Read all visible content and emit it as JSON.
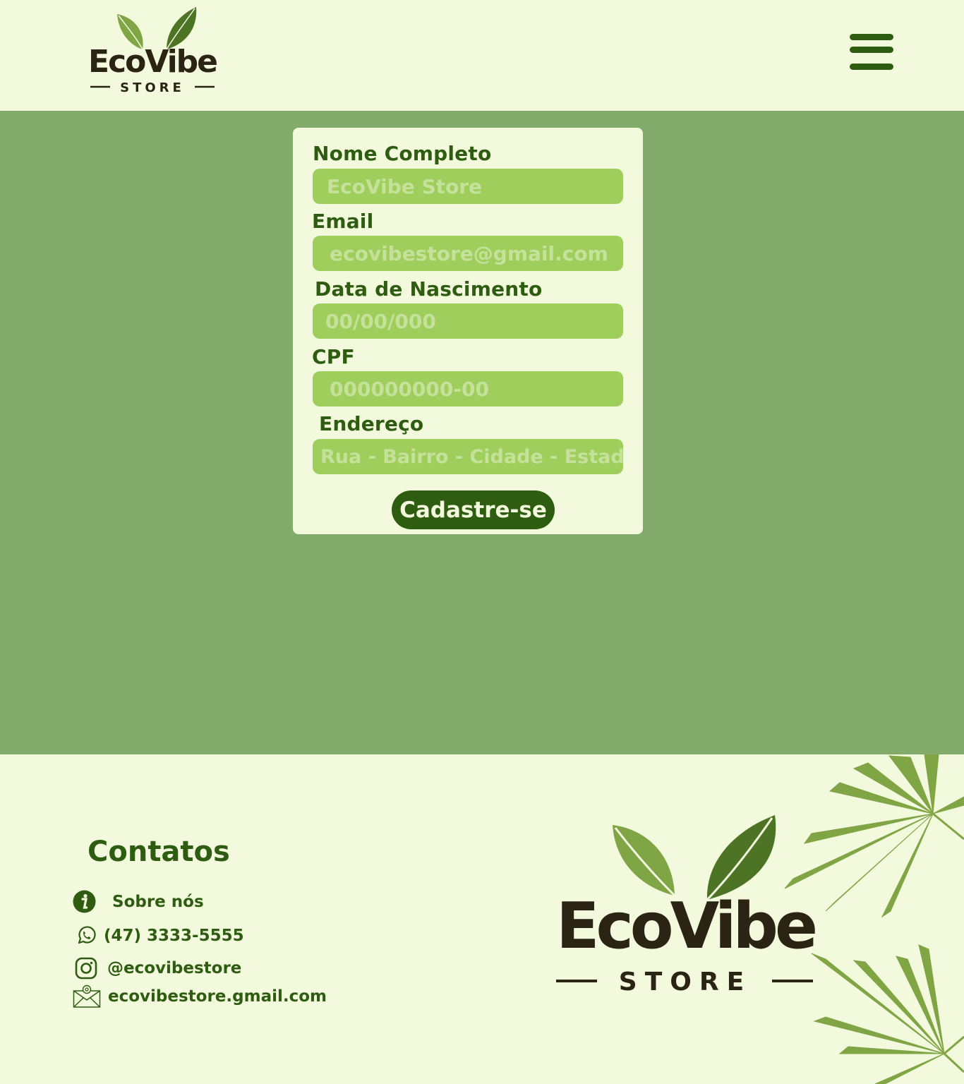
{
  "brand": {
    "name": "EcoVibe",
    "tagline": "STORE"
  },
  "colors": {
    "page_bg": "#f3f9dc",
    "main_bg": "#82aa6b",
    "input_bg": "#9fce5d",
    "accent_dark": "#2e5d11"
  },
  "header": {
    "menu_icon": "hamburger-menu-icon"
  },
  "form": {
    "fields": [
      {
        "label": "Nome Completo",
        "placeholder": "EcoVibe Store"
      },
      {
        "label": "Email",
        "placeholder": "ecovibestore@gmail.com"
      },
      {
        "label": "Data de Nascimento",
        "placeholder": "00/00/000"
      },
      {
        "label": "CPF",
        "placeholder": "000000000-00"
      },
      {
        "label": "Endereço",
        "placeholder": "Rua - Bairro - Cidade - Estado"
      }
    ],
    "submit_label": "Cadastre-se"
  },
  "footer": {
    "contacts_title": "Contatos",
    "items": [
      {
        "icon": "info-icon",
        "text": "Sobre nós"
      },
      {
        "icon": "whatsapp-icon",
        "text": "(47) 3333-5555"
      },
      {
        "icon": "instagram-icon",
        "text": "@ecovibestore"
      },
      {
        "icon": "email-icon",
        "text": "ecovibestore.gmail.com"
      }
    ]
  }
}
